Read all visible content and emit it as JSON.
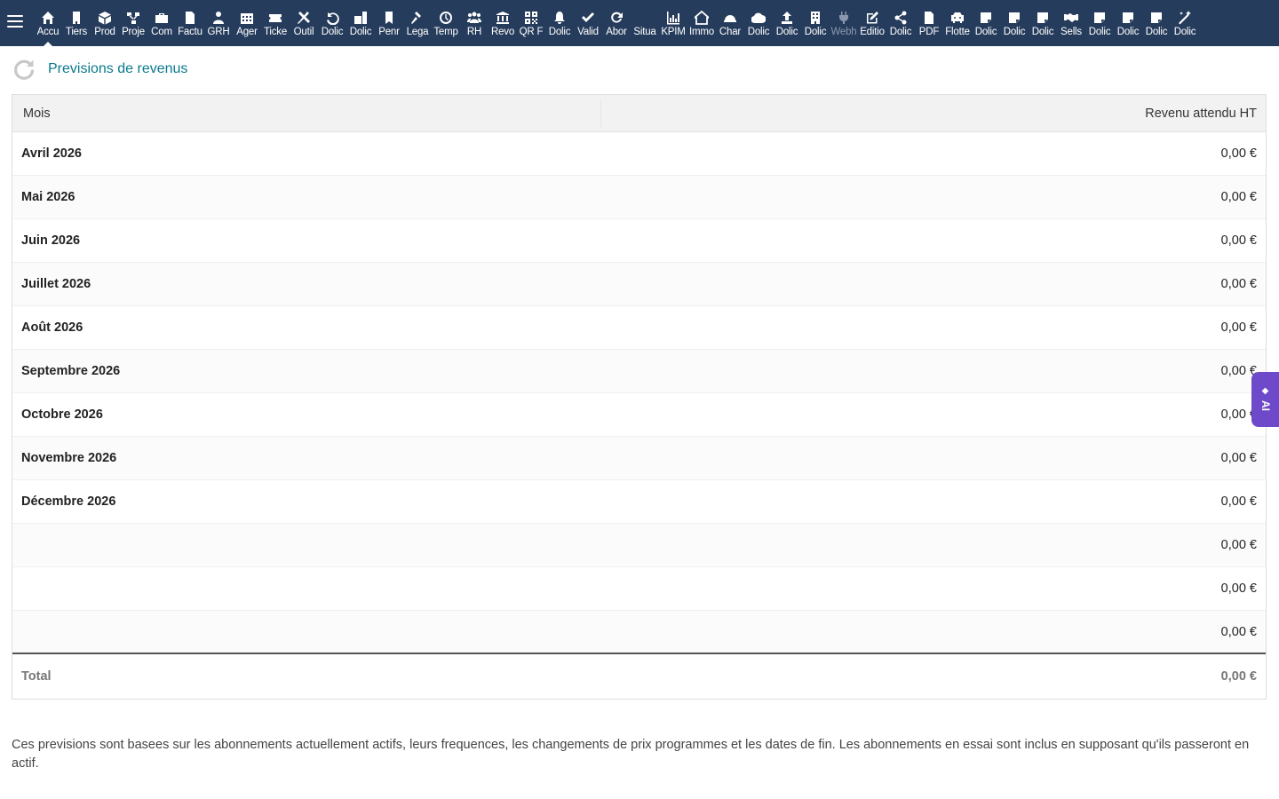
{
  "topbar": {
    "menu": [
      {
        "label": "Accu",
        "icon": "home-icon",
        "active": true
      },
      {
        "label": "Tiers",
        "icon": "building-icon"
      },
      {
        "label": "Prod",
        "icon": "cube-icon"
      },
      {
        "label": "Proje",
        "icon": "project-icon"
      },
      {
        "label": "Com",
        "icon": "briefcase-icon"
      },
      {
        "label": "Factu",
        "icon": "invoice-icon"
      },
      {
        "label": "GRH",
        "icon": "users-icon"
      },
      {
        "label": "Ager",
        "icon": "calendar-icon"
      },
      {
        "label": "Ticke",
        "icon": "ticket-icon"
      },
      {
        "label": "Outil",
        "icon": "tools-icon"
      },
      {
        "label": "Dolic",
        "icon": "undo-icon"
      },
      {
        "label": "Dolic",
        "icon": "module-icon"
      },
      {
        "label": "Penr",
        "icon": "bookmark-icon"
      },
      {
        "label": "Lega",
        "icon": "gavel-icon"
      },
      {
        "label": "Temp",
        "icon": "clock-icon"
      },
      {
        "label": "RH",
        "icon": "group-icon"
      },
      {
        "label": "Revo",
        "icon": "bank-icon"
      },
      {
        "label": "QR F",
        "icon": "qrcode-icon"
      },
      {
        "label": "Dolic",
        "icon": "bell-icon"
      },
      {
        "label": "Valid",
        "icon": "double-check-icon"
      },
      {
        "label": "Abor",
        "icon": "refresh-icon"
      },
      {
        "label": "Situa",
        "icon": "blank-icon"
      },
      {
        "label": "KPIM",
        "icon": "chart-bar-icon"
      },
      {
        "label": "Immo",
        "icon": "house-icon"
      },
      {
        "label": "Char",
        "icon": "helmet-icon"
      },
      {
        "label": "Dolic",
        "icon": "cloud-icon"
      },
      {
        "label": "Dolic",
        "icon": "upload-icon"
      },
      {
        "label": "Dolic",
        "icon": "office-building-icon"
      },
      {
        "label": "Webh",
        "icon": "plug-icon",
        "dim": true
      },
      {
        "label": "Editio",
        "icon": "edit-icon"
      },
      {
        "label": "Dolic",
        "icon": "share-icon"
      },
      {
        "label": "PDF",
        "icon": "file-pdf-icon"
      },
      {
        "label": "Flotte",
        "icon": "car-icon"
      },
      {
        "label": "Dolic",
        "icon": "note-icon"
      },
      {
        "label": "Dolic",
        "icon": "note-icon"
      },
      {
        "label": "Dolic",
        "icon": "note-icon"
      },
      {
        "label": "Sells",
        "icon": "handshake-icon"
      },
      {
        "label": "Dolic",
        "icon": "note-icon"
      },
      {
        "label": "Dolic",
        "icon": "note-icon"
      },
      {
        "label": "Dolic",
        "icon": "note-icon"
      },
      {
        "label": "Dolic",
        "icon": "magic-wand-icon"
      }
    ]
  },
  "page": {
    "title": "Previsions de revenus"
  },
  "table": {
    "headers": {
      "month": "Mois",
      "revenue": "Revenu attendu HT"
    },
    "rows": [
      {
        "month": "Avril 2026",
        "value": "0,00 €"
      },
      {
        "month": "Mai 2026",
        "value": "0,00 €"
      },
      {
        "month": "Juin 2026",
        "value": "0,00 €"
      },
      {
        "month": "Juillet 2026",
        "value": "0,00 €"
      },
      {
        "month": "Août 2026",
        "value": "0,00 €"
      },
      {
        "month": "Septembre 2026",
        "value": "0,00 €"
      },
      {
        "month": "Octobre 2026",
        "value": "0,00 €"
      },
      {
        "month": "Novembre 2026",
        "value": "0,00 €"
      },
      {
        "month": "Décembre 2026",
        "value": "0,00 €"
      },
      {
        "month": "",
        "value": "0,00 €"
      },
      {
        "month": "",
        "value": "0,00 €"
      },
      {
        "month": "",
        "value": "0,00 €"
      }
    ],
    "total": {
      "label": "Total",
      "value": "0,00 €"
    }
  },
  "note": "Ces previsions sont basees sur les abonnements actuellement actifs, leurs frequences, les changements de prix programmes et les dates de fin. Les abonnements en essai sont inclus en supposant qu'ils passeront en actif.",
  "ai_tab": {
    "label": "AI",
    "icon": "sparkle-icon",
    "color": "#6e49c9"
  },
  "colors": {
    "topbar": "#263c5c",
    "title": "#0a7b8c"
  }
}
